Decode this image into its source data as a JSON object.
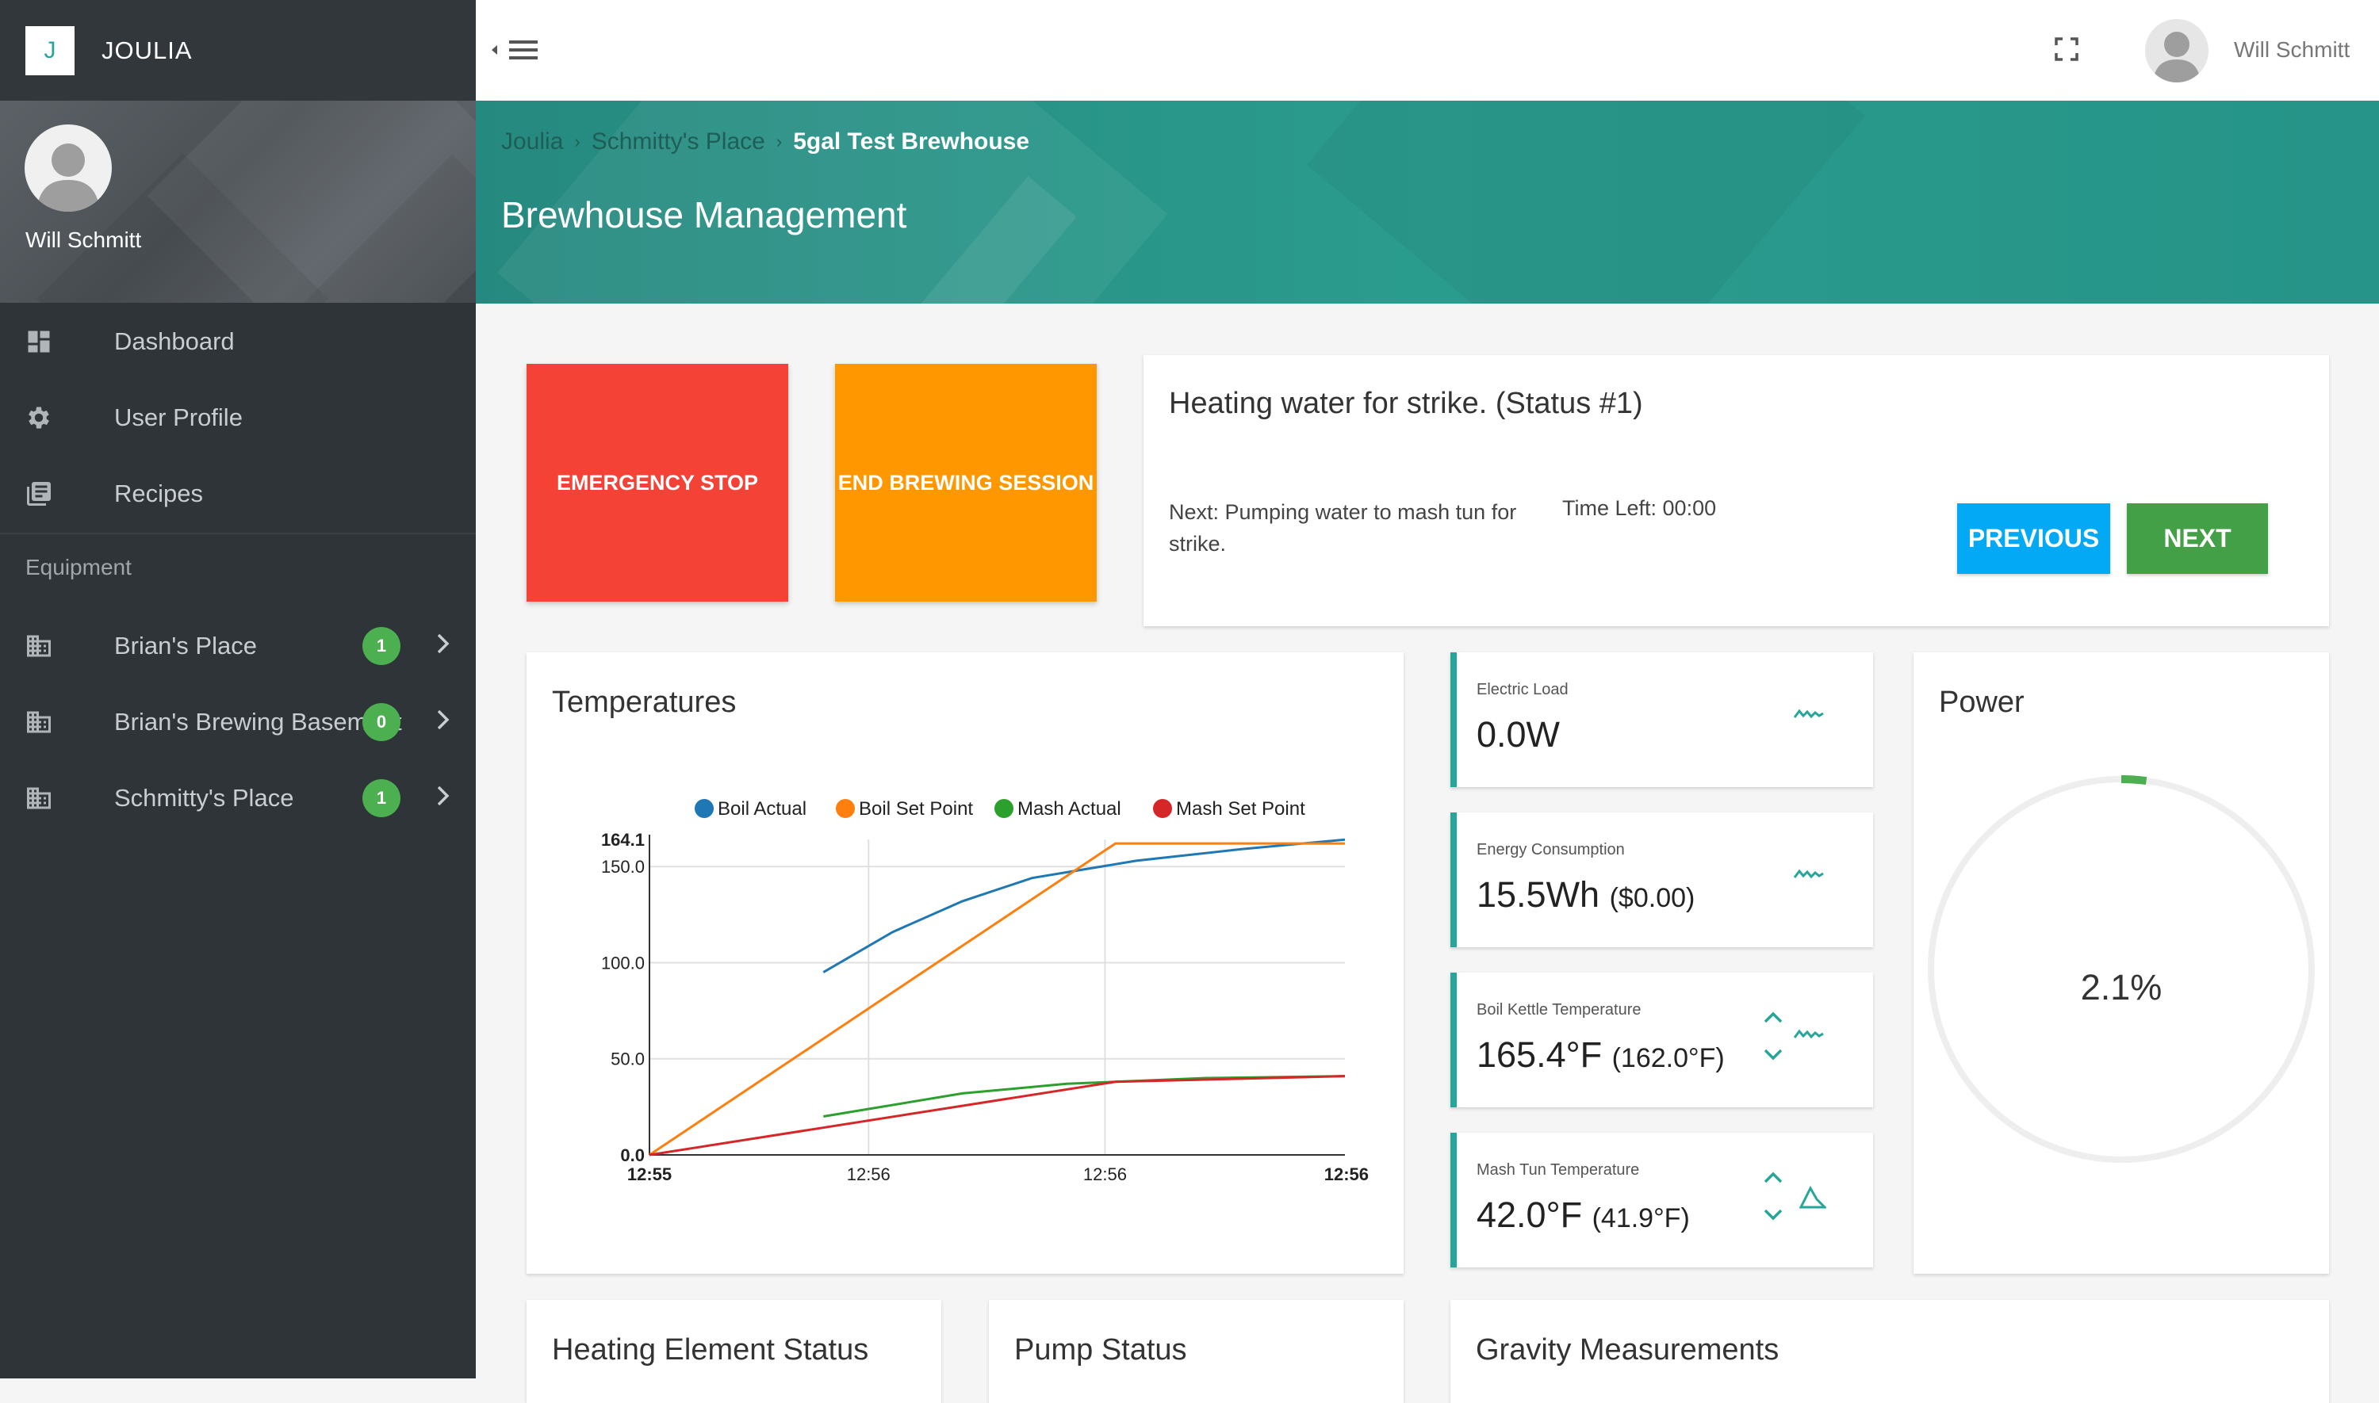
{
  "brand": {
    "logo_letter": "J",
    "name": "JOULIA"
  },
  "sidebar": {
    "user_name": "Will Schmitt",
    "items": [
      {
        "label": "Dashboard",
        "icon": "dashboard-icon"
      },
      {
        "label": "User Profile",
        "icon": "gear-icon"
      },
      {
        "label": "Recipes",
        "icon": "library-books-icon"
      }
    ],
    "equipment_header": "Equipment",
    "equipment": [
      {
        "label": "Brian's Place",
        "badge": "1",
        "icon": "building-icon"
      },
      {
        "label": "Brian's Brewing Basement",
        "badge": "0",
        "icon": "building-icon"
      },
      {
        "label": "Schmitty's Place",
        "badge": "1",
        "icon": "building-icon"
      }
    ]
  },
  "topbar": {
    "user_name": "Will Schmitt"
  },
  "header": {
    "breadcrumb": [
      "Joulia",
      "Schmitty's Place",
      "5gal Test Brewhouse"
    ],
    "title": "Brewhouse Management"
  },
  "actions": {
    "emergency_stop": "EMERGENCY STOP",
    "end_session": "END BREWING SESSION"
  },
  "status": {
    "title": "Heating water for strike.  (Status #1)",
    "next": "Next: Pumping water to mash tun for strike.",
    "time_left": "Time Left: 00:00",
    "previous_label": "PREVIOUS",
    "next_label": "NEXT"
  },
  "temperatures": {
    "title": "Temperatures"
  },
  "metrics": {
    "electric_load": {
      "label": "Electric Load",
      "value": "0.0W"
    },
    "energy": {
      "label": "Energy Consumption",
      "value": "15.5Wh",
      "sub": "($0.00)"
    },
    "boil_kettle": {
      "label": "Boil Kettle Temperature",
      "value": "165.4°F",
      "sub": "(162.0°F)"
    },
    "mash_tun": {
      "label": "Mash Tun Temperature",
      "value": "42.0°F",
      "sub": "(41.9°F)"
    }
  },
  "power": {
    "title": "Power",
    "value": "2.1%",
    "fraction": 0.021,
    "color": "#4caf50"
  },
  "bottom_cards": {
    "heating": "Heating Element Status",
    "pump": "Pump Status",
    "gravity": "Gravity Measurements"
  },
  "colors": {
    "teal": "#26a69a",
    "red": "#f44336",
    "orange": "#ff9800",
    "blue": "#03a9f4",
    "green": "#43a047"
  },
  "chart_data": {
    "type": "line",
    "title": "",
    "xlabel": "",
    "ylabel": "",
    "x_ticks": [
      "12:55",
      "12:56",
      "12:56",
      "12:56"
    ],
    "y_ticks": [
      "0.0",
      "50.0",
      "100.0",
      "150.0",
      "164.1"
    ],
    "ylim": [
      0,
      164.1
    ],
    "legend_position": "top",
    "series": [
      {
        "name": "Boil Actual",
        "color": "#1f77b4",
        "points": [
          [
            0.25,
            95
          ],
          [
            0.35,
            116
          ],
          [
            0.45,
            132
          ],
          [
            0.55,
            144
          ],
          [
            0.7,
            153
          ],
          [
            0.85,
            159
          ],
          [
            1.0,
            164
          ]
        ]
      },
      {
        "name": "Boil Set Point",
        "color": "#ff7f0e",
        "points": [
          [
            0,
            0
          ],
          [
            0.67,
            162
          ],
          [
            1.0,
            162
          ]
        ]
      },
      {
        "name": "Mash Actual",
        "color": "#2ca02c",
        "points": [
          [
            0.25,
            20
          ],
          [
            0.45,
            32
          ],
          [
            0.6,
            37
          ],
          [
            0.8,
            40
          ],
          [
            1.0,
            41
          ]
        ]
      },
      {
        "name": "Mash Set Point",
        "color": "#d62728",
        "points": [
          [
            0,
            0
          ],
          [
            0.67,
            38
          ],
          [
            1.0,
            41
          ]
        ]
      }
    ]
  }
}
